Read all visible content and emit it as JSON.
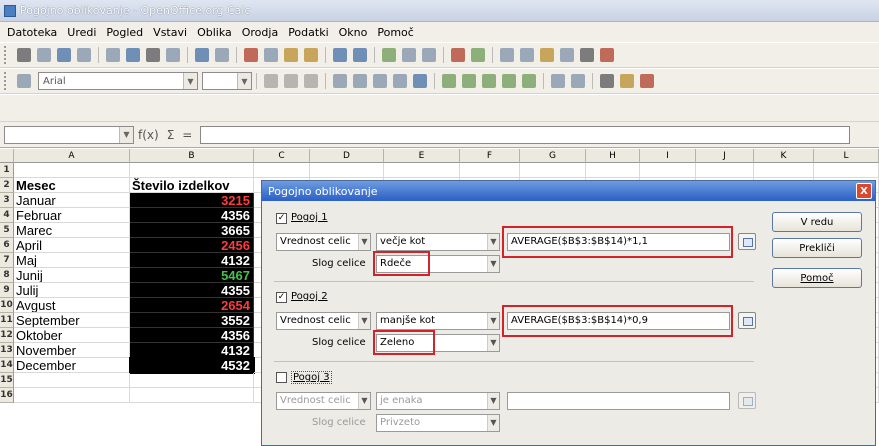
{
  "window": {
    "title": "Pogojno oblikovanje - OpenOffice.org Calc"
  },
  "menu": [
    "Datoteka",
    "Uredi",
    "Pogled",
    "Vstavi",
    "Oblika",
    "Orodja",
    "Podatki",
    "Okno",
    "Pomoč"
  ],
  "format_toolbar": {
    "font_name": "Arial",
    "font_size": ""
  },
  "formula_bar": {
    "name_box": "",
    "formula": ""
  },
  "columns": [
    "A",
    "B",
    "C",
    "D",
    "E",
    "F",
    "G",
    "H",
    "I",
    "J",
    "K",
    "L"
  ],
  "sheet": {
    "header": [
      "Mesec",
      "Število izdelkov"
    ],
    "rows": [
      {
        "n": "1",
        "month": "",
        "value": ""
      },
      {
        "n": "2",
        "month": "Mesec",
        "value": "Število izdelkov"
      },
      {
        "n": "3",
        "month": "Januar",
        "value": "3215",
        "color": "#ff3b3b"
      },
      {
        "n": "4",
        "month": "Februar",
        "value": "4356",
        "color": "#ffffff"
      },
      {
        "n": "5",
        "month": "Marec",
        "value": "3665",
        "color": "#ffffff"
      },
      {
        "n": "6",
        "month": "April",
        "value": "2456",
        "color": "#ff3b3b"
      },
      {
        "n": "7",
        "month": "Maj",
        "value": "4132",
        "color": "#ffffff"
      },
      {
        "n": "8",
        "month": "Junij",
        "value": "5467",
        "color": "#44c24a"
      },
      {
        "n": "9",
        "month": "Julij",
        "value": "4355",
        "color": "#ffffff"
      },
      {
        "n": "10",
        "month": "Avgust",
        "value": "2654",
        "color": "#ff3b3b"
      },
      {
        "n": "11",
        "month": "September",
        "value": "3552",
        "color": "#ffffff"
      },
      {
        "n": "12",
        "month": "Oktober",
        "value": "4356",
        "color": "#ffffff"
      },
      {
        "n": "13",
        "month": "November",
        "value": "4132",
        "color": "#ffffff"
      },
      {
        "n": "14",
        "month": "December",
        "value": "4532",
        "color": "#ffffff"
      },
      {
        "n": "15",
        "month": "",
        "value": ""
      },
      {
        "n": "16",
        "month": "",
        "value": ""
      }
    ]
  },
  "dialog": {
    "title": "Pogojno oblikovanje",
    "close": "X",
    "cond1": {
      "label": "Pogoj 1",
      "checked": "✓",
      "type": "Vrednost celic",
      "op": "večje kot",
      "formula": "AVERAGE($B$3:$B$14)*1,1",
      "style_label": "Slog celice",
      "style": "Rdeče"
    },
    "cond2": {
      "label": "Pogoj 2",
      "checked": "✓",
      "type": "Vrednost celic",
      "op": "manjše kot",
      "formula": "AVERAGE($B$3:$B$14)*0,9",
      "style_label": "Slog celice",
      "style": "Zeleno"
    },
    "cond3": {
      "label": "Pogoj 3",
      "checked": "",
      "type": "Vrednost celic",
      "op": "je enaka",
      "formula": "",
      "style_label": "Slog celice",
      "style": "Privzeto"
    },
    "buttons": {
      "ok": "V redu",
      "cancel": "Prekliči",
      "help": "Pomoč"
    }
  }
}
